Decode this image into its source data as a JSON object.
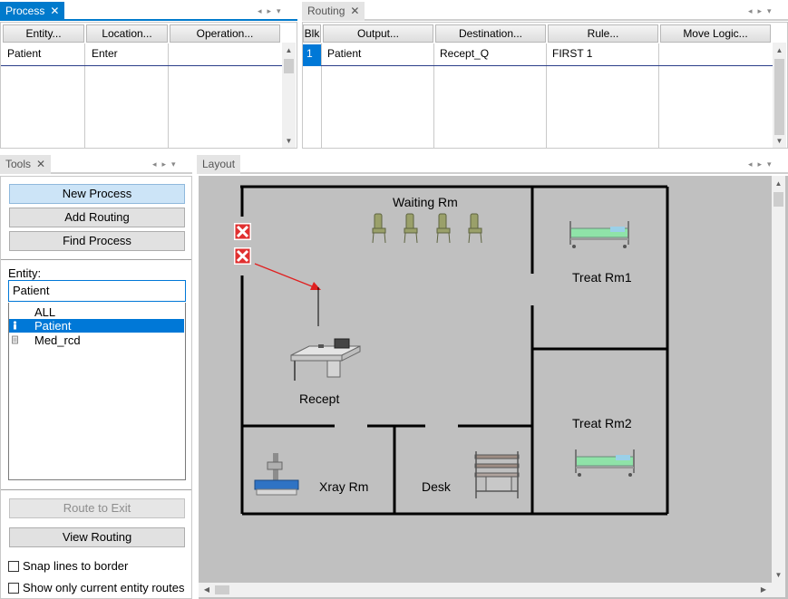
{
  "process_panel": {
    "tab_label": "Process",
    "columns": [
      "Entity...",
      "Location...",
      "Operation..."
    ],
    "rows": [
      {
        "entity": "Patient",
        "location": "Enter",
        "operation": ""
      }
    ]
  },
  "routing_panel": {
    "tab_label": "Routing",
    "columns": [
      "Blk",
      "Output...",
      "Destination...",
      "Rule...",
      "Move Logic..."
    ],
    "rows": [
      {
        "blk": "1",
        "output": "Patient",
        "destination": "Recept_Q",
        "rule": "FIRST 1",
        "move_logic": ""
      }
    ]
  },
  "tools_panel": {
    "tab_label": "Tools",
    "buttons": {
      "new_process": "New Process",
      "add_routing": "Add Routing",
      "find_process": "Find Process",
      "route_to_exit": "Route to Exit",
      "view_routing": "View Routing"
    },
    "entity_label": "Entity:",
    "entity_value": "Patient",
    "entity_list": [
      {
        "name": "ALL"
      },
      {
        "name": "Patient",
        "selected": true
      },
      {
        "name": "Med_rcd"
      }
    ],
    "checkboxes": {
      "snap_lines": "Snap lines to border",
      "show_only_current": "Show only current entity routes"
    }
  },
  "layout_panel": {
    "tab_label": "Layout",
    "rooms": {
      "waiting": "Waiting Rm",
      "treat1": "Treat Rm1",
      "recept": "Recept",
      "treat2": "Treat Rm2",
      "xray": "Xray Rm",
      "desk": "Desk"
    }
  },
  "icons": [
    "close-icon",
    "pin-icon",
    "dropdown-icon",
    "scroll-up-icon",
    "scroll-down-icon",
    "scroll-left-icon",
    "scroll-right-icon",
    "chair-icon",
    "bed-icon",
    "desk-icon",
    "xray-machine-icon",
    "cart-icon",
    "entry-location-icon",
    "patient-icon",
    "med-record-icon"
  ],
  "colors": {
    "accent": "#007acc",
    "selection": "#0078d7",
    "layout_bg": "#c0c0c0",
    "route_arrow": "#e02020"
  }
}
